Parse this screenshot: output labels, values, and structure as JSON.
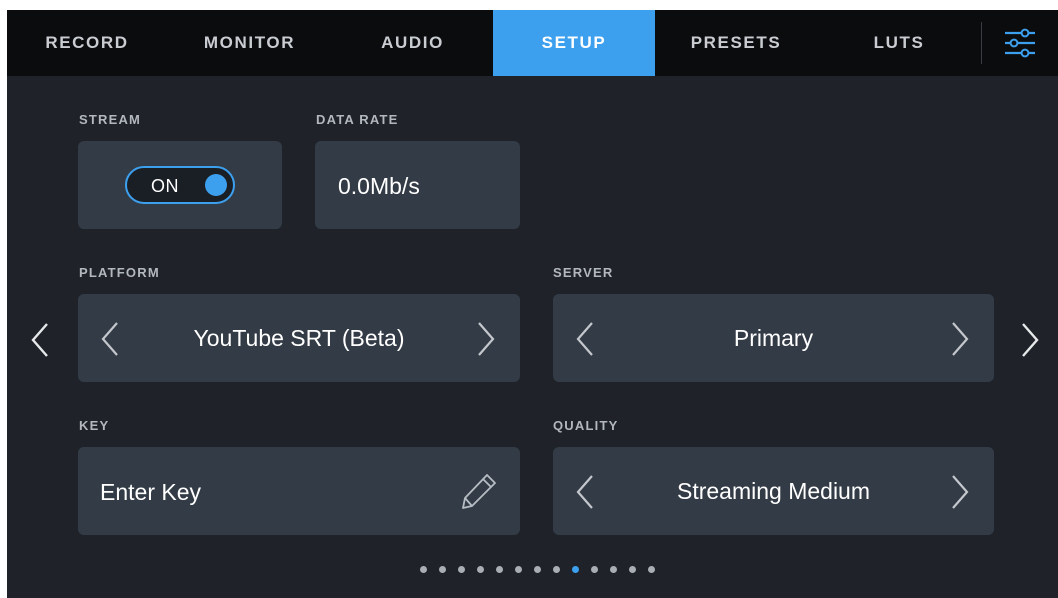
{
  "tabs": [
    {
      "label": "RECORD",
      "active": false
    },
    {
      "label": "MONITOR",
      "active": false
    },
    {
      "label": "AUDIO",
      "active": false
    },
    {
      "label": "SETUP",
      "active": true
    },
    {
      "label": "PRESETS",
      "active": false
    },
    {
      "label": "LUTS",
      "active": false
    }
  ],
  "settings_icon": "sliders-icon",
  "stream": {
    "label": "STREAM",
    "toggle_text": "ON",
    "state": "on"
  },
  "data_rate": {
    "label": "DATA RATE",
    "value": "0.0Mb/s"
  },
  "platform": {
    "label": "PLATFORM",
    "value": "YouTube SRT (Beta)"
  },
  "server": {
    "label": "SERVER",
    "value": "Primary"
  },
  "key": {
    "label": "KEY",
    "value": "Enter Key",
    "icon": "pencil-icon"
  },
  "quality": {
    "label": "QUALITY",
    "value": "Streaming Medium"
  },
  "pagination": {
    "total": 13,
    "current": 9
  },
  "colors": {
    "accent": "#3da0ef",
    "panel": "#333b46",
    "background": "#1f2329",
    "tabbar": "#0b0c0e"
  }
}
